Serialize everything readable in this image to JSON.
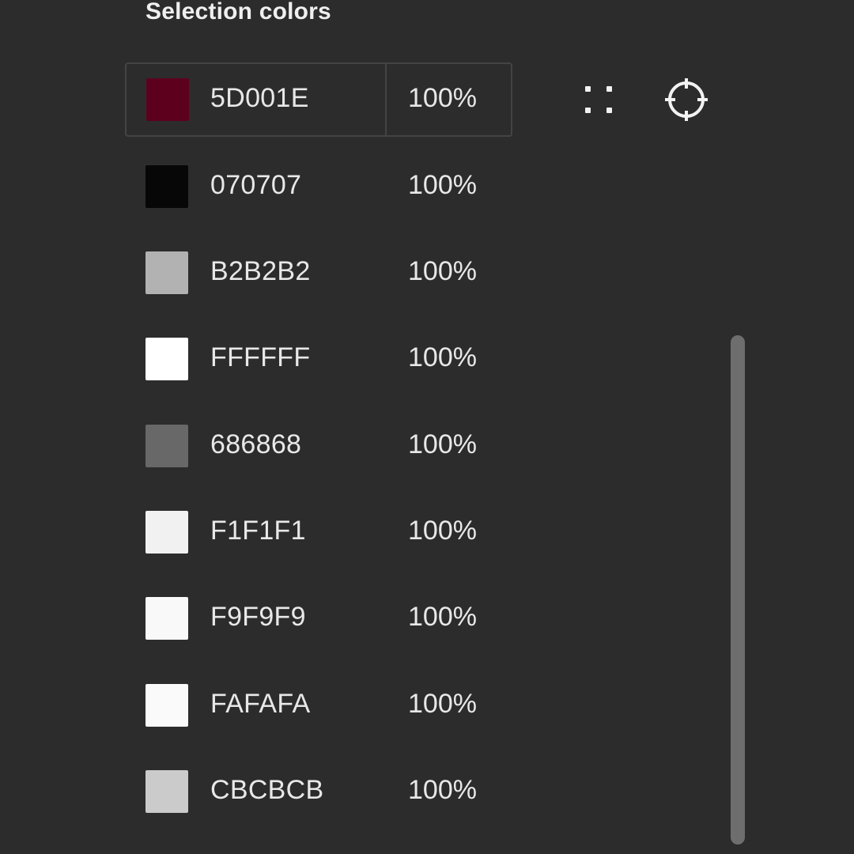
{
  "section": {
    "title": "Selection colors"
  },
  "colors": [
    {
      "hex": "5D001E",
      "opacity": "100%",
      "swatch": "#5D001E"
    },
    {
      "hex": "070707",
      "opacity": "100%",
      "swatch": "#070707"
    },
    {
      "hex": "B2B2B2",
      "opacity": "100%",
      "swatch": "#B2B2B2"
    },
    {
      "hex": "FFFFFF",
      "opacity": "100%",
      "swatch": "#FFFFFF"
    },
    {
      "hex": "686868",
      "opacity": "100%",
      "swatch": "#686868"
    },
    {
      "hex": "F1F1F1",
      "opacity": "100%",
      "swatch": "#F1F1F1"
    },
    {
      "hex": "F9F9F9",
      "opacity": "100%",
      "swatch": "#F9F9F9"
    },
    {
      "hex": "FAFAFA",
      "opacity": "100%",
      "swatch": "#FAFAFA"
    },
    {
      "hex": "CBCBCB",
      "opacity": "100%",
      "swatch": "#CBCBCB"
    }
  ],
  "selected_index": 0,
  "icons": {
    "style_icon": "grid-dots-icon",
    "select_icon": "target-crosshair-icon"
  },
  "theme": {
    "background": "#2c2c2c",
    "text": "#e8e8e8",
    "border": "#444444",
    "scrollbar": "#6e6e6e"
  }
}
